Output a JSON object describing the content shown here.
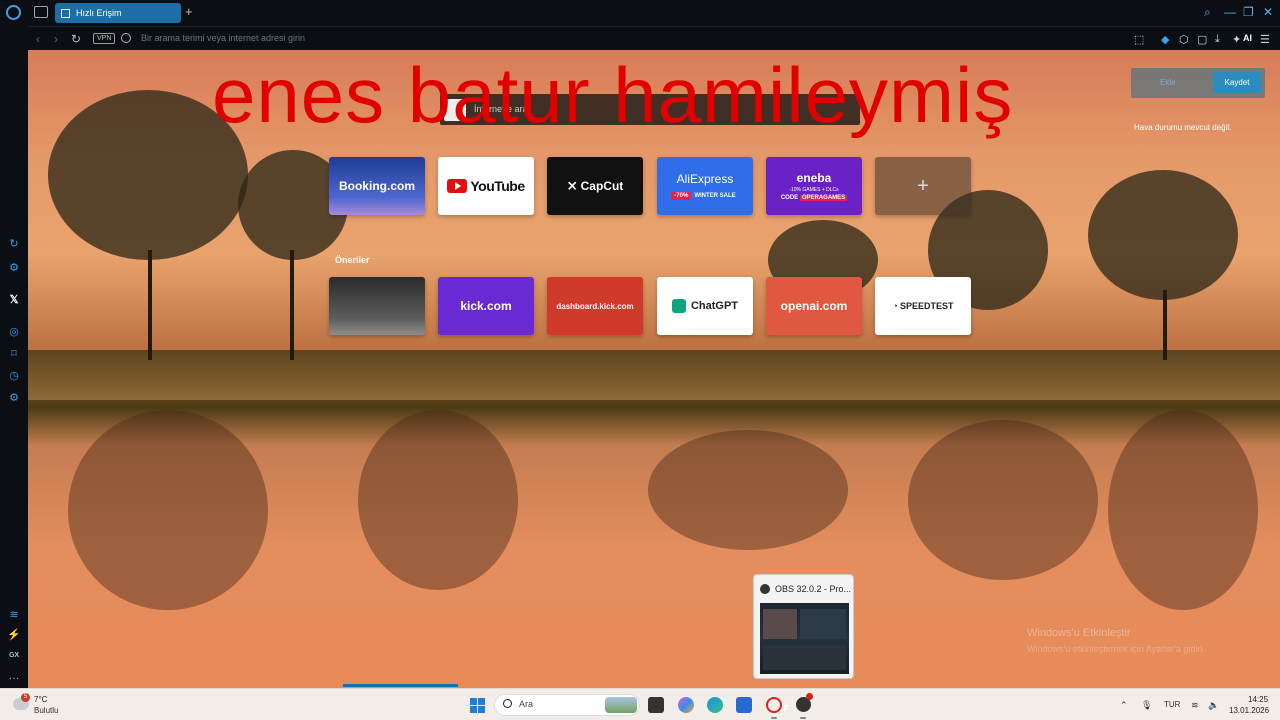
{
  "browser": {
    "tab_label": "Hızlı Erişim",
    "new_tab": "+",
    "address_placeholder": "Bir arama terimi veya internet adresi girin",
    "vpn_label": "VPN",
    "ai_label": "AI",
    "accent_color": "#1c6fa6"
  },
  "overlay_text": "enes batur hamileymiş",
  "speed_dial": {
    "search_placeholder": "İnternette ara",
    "suggestions_label": "Öneriler",
    "row1": [
      {
        "label": "Booking.com",
        "icon": "booking-logo"
      },
      {
        "label": "YouTube",
        "icon": "youtube-logo"
      },
      {
        "label": "CapCut",
        "icon": "capcut-logo"
      },
      {
        "label": "AliExpress",
        "badge_pct": "-70%",
        "badge_text": "WINTER SALE"
      },
      {
        "label": "eneba",
        "sub": "-10% GAMES + DLCs",
        "code_label": "CODE",
        "code": "OPERAGAMES"
      },
      {
        "label": "+"
      }
    ],
    "row2": [
      {
        "label": ""
      },
      {
        "label": "kick.com"
      },
      {
        "label": "dashboard.kick.com"
      },
      {
        "label": "ChatGPT",
        "icon": "chatgpt-logo"
      },
      {
        "label": "openai.com"
      },
      {
        "label": "SPEEDTEST",
        "icon": "speedtest-logo"
      }
    ]
  },
  "weather": {
    "button_left": "Ekle",
    "button_right": "Kaydet",
    "message": "Hava durumu mevcut değil."
  },
  "activation": {
    "title": "Windows'u Etkinleştir",
    "subtitle": "Windows'u etkinleştirmek için Ayarlar'a gidin."
  },
  "obs_popup": {
    "title": "OBS 32.0.2 - Pro..."
  },
  "taskbar": {
    "badge": "5",
    "temperature": "7°C",
    "condition": "Bulutlu",
    "search_label": "Ara",
    "language": "TUR",
    "time": "14:25",
    "date": "13.01.2026"
  }
}
